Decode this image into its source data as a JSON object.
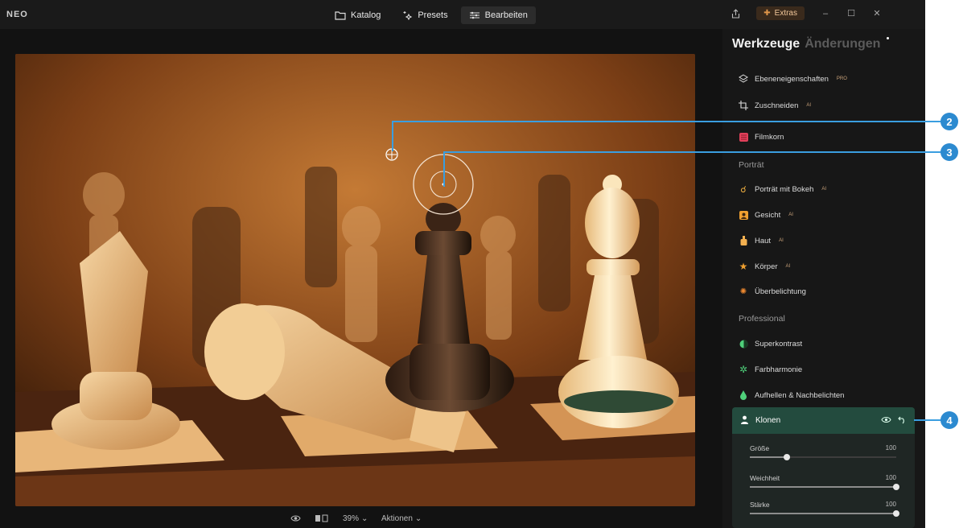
{
  "app": {
    "logo": "NEO"
  },
  "nav": [
    {
      "label": "Katalog",
      "icon": "folder-icon"
    },
    {
      "label": "Presets",
      "icon": "sparkle-icon"
    },
    {
      "label": "Bearbeiten",
      "icon": "sliders-icon"
    }
  ],
  "topright": {
    "extras_label": "Extras"
  },
  "bottombar": {
    "zoom": "39%",
    "actions": "Aktionen"
  },
  "panel": {
    "tabs": [
      {
        "label": "Werkzeuge"
      },
      {
        "label": "Änderungen"
      }
    ],
    "tools": [
      {
        "label": "Ebeneneigenschaften",
        "badge": "PRO",
        "icon": "layers-icon"
      },
      {
        "label": "Zuschneiden",
        "badge": "AI",
        "icon": "crop-icon"
      },
      {
        "label": "Filmkorn",
        "badge": "",
        "icon": "film-icon"
      }
    ],
    "sections": {
      "portrait": "Porträt",
      "professional": "Professional"
    },
    "portrait_tools": [
      {
        "label": "Porträt mit Bokeh",
        "badge": "AI",
        "icon": "bokeh-icon"
      },
      {
        "label": "Gesicht",
        "badge": "AI",
        "icon": "face-icon"
      },
      {
        "label": "Haut",
        "badge": "AI",
        "icon": "skin-icon"
      },
      {
        "label": "Körper",
        "badge": "AI",
        "icon": "body-icon"
      },
      {
        "label": "Überbelichtung",
        "badge": "",
        "icon": "overexposure-icon"
      }
    ],
    "pro_tools": [
      {
        "label": "Superkontrast",
        "icon": "contrast-icon"
      },
      {
        "label": "Farbharmonie",
        "icon": "gear-icon"
      },
      {
        "label": "Aufhellen & Nachbelichten",
        "icon": "drop-icon"
      }
    ],
    "clone": {
      "title": "Klonen",
      "sliders": [
        {
          "label": "Größe",
          "value": "100",
          "level": 0.25
        },
        {
          "label": "Weichheit",
          "value": "100",
          "level": 1.0
        },
        {
          "label": "Stärke",
          "value": "100",
          "level": 1.0
        }
      ]
    }
  },
  "callouts": [
    "2",
    "3",
    "4"
  ],
  "colors": {
    "accent": "#2c8ad0",
    "clone_header": "#234b3e",
    "extras": "#f2c79a"
  }
}
